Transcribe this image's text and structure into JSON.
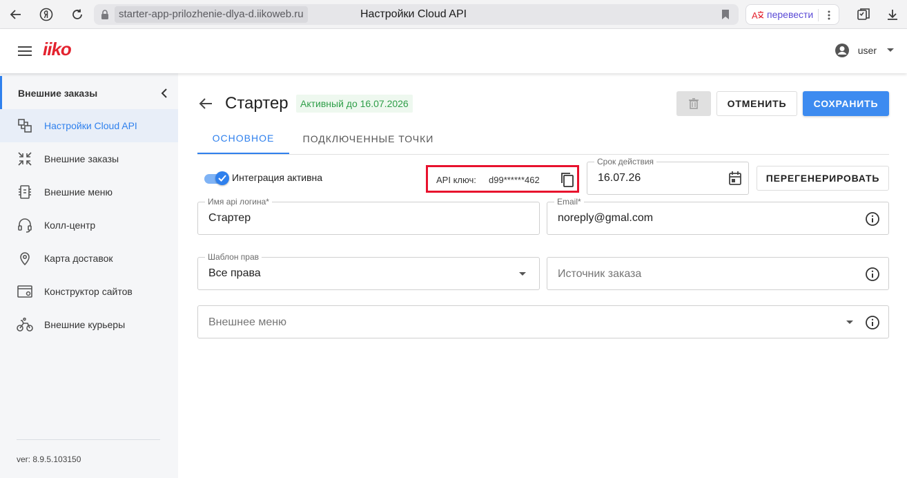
{
  "browser": {
    "url": "starter-app-prilozhenie-dlya-d.iikoweb.ru",
    "tab_title": "Настройки Cloud API",
    "translate_label": "перевести"
  },
  "header": {
    "logo": "iiko",
    "username": "user"
  },
  "sidebar": {
    "section_title": "Внешние заказы",
    "items": [
      {
        "label": "Настройки Cloud API",
        "icon": "api-settings-icon",
        "active": true
      },
      {
        "label": "Внешние заказы",
        "icon": "external-orders-icon"
      },
      {
        "label": "Внешние меню",
        "icon": "external-menu-icon"
      },
      {
        "label": "Колл-центр",
        "icon": "headset-icon"
      },
      {
        "label": "Карта доставок",
        "icon": "map-pin-icon"
      },
      {
        "label": "Конструктор сайтов",
        "icon": "site-builder-icon"
      },
      {
        "label": "Внешние курьеры",
        "icon": "bicycle-icon"
      }
    ],
    "version": "ver: 8.9.5.103150"
  },
  "main": {
    "title": "Стартер",
    "status_badge": "Активный до 16.07.2026",
    "buttons": {
      "cancel": "ОТМЕНИТЬ",
      "save": "СОХРАНИТЬ",
      "regenerate": "ПЕРЕГЕНЕРИРОВАТЬ"
    },
    "tabs": [
      {
        "label": "ОСНОВНОЕ",
        "active": true
      },
      {
        "label": "ПОДКЛЮЧЕННЫЕ ТОЧКИ"
      }
    ],
    "integration": {
      "label": "Интеграция активна",
      "enabled": true
    },
    "api_key": {
      "label": "API ключ:",
      "value": "d99******462"
    },
    "expiry": {
      "label": "Срок действия",
      "value": "16.07.26"
    },
    "login": {
      "label": "Имя api логина*",
      "value": "Стартер"
    },
    "email": {
      "label": "Email*",
      "value": "noreply@gmal.com"
    },
    "rights_template": {
      "label": "Шаблон прав",
      "value": "Все права"
    },
    "order_source": {
      "placeholder": "Источник заказа"
    },
    "external_menu": {
      "placeholder": "Внешнее меню"
    }
  },
  "colors": {
    "accent": "#2f80ed",
    "save_button": "#3d8bf0",
    "status_green": "#2e9e48",
    "highlight_red": "#e8112d",
    "logo_red": "#e3232f"
  }
}
